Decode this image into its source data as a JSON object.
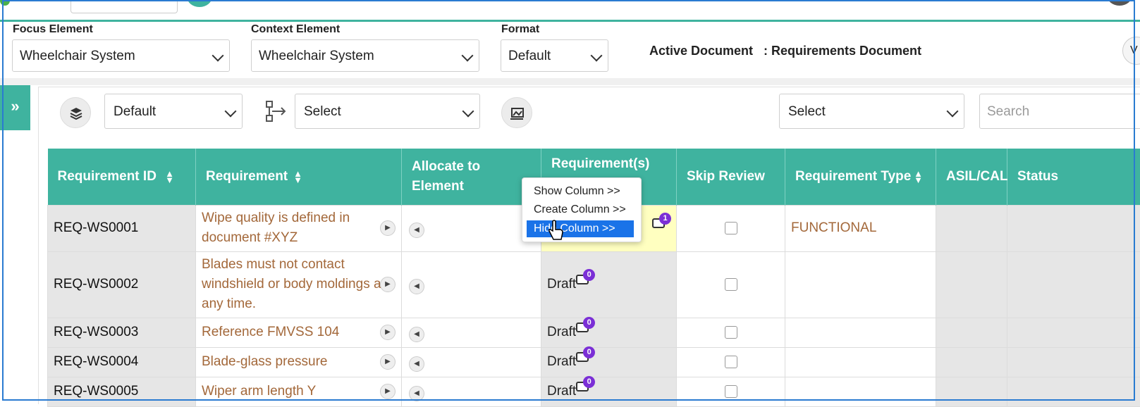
{
  "filters": {
    "focus_label": "Focus Element",
    "focus_value": "Wheelchair System",
    "context_label": "Context Element",
    "context_value": "Wheelchair System",
    "format_label": "Format",
    "format_value": "Default",
    "active_doc_label": "Active Document",
    "active_doc_value": ": Requirements Document"
  },
  "sidebar": {
    "toggle": "»"
  },
  "toolbar": {
    "layer_select": "Default",
    "flow_select": "Select",
    "right_select": "Select",
    "search_placeholder": "Search"
  },
  "table": {
    "headers": [
      "Requirement ID",
      "Requirement",
      "Allocate to Element",
      "Requirement(s)",
      "Skip Review",
      "Requirement Type",
      "ASIL/CAL",
      "Status"
    ],
    "rows": [
      {
        "id": "REQ-WS0001",
        "req": "Wipe quality is defined in document #XYZ",
        "status": "",
        "count": "1",
        "type": "FUNCTIONAL"
      },
      {
        "id": "REQ-WS0002",
        "req": "Blades must not contact windshield or body moldings at any time.",
        "status": "Draft",
        "count": "0",
        "type": ""
      },
      {
        "id": "REQ-WS0003",
        "req": "Reference FMVSS 104",
        "status": "Draft",
        "count": "0",
        "type": ""
      },
      {
        "id": "REQ-WS0004",
        "req": "Blade-glass pressure",
        "status": "Draft",
        "count": "0",
        "type": ""
      },
      {
        "id": "REQ-WS0005",
        "req": "Wiper arm length Y",
        "status": "Draft",
        "count": "0",
        "type": ""
      }
    ]
  },
  "context_menu": {
    "show": "Show Column >>",
    "create": "Create Column >>",
    "hide": "Hide Column >>"
  },
  "colors": {
    "accent": "#3fb39f",
    "req_text": "#a3683a",
    "badge": "#7b2fd6",
    "menu_highlight": "#1a73e8"
  }
}
